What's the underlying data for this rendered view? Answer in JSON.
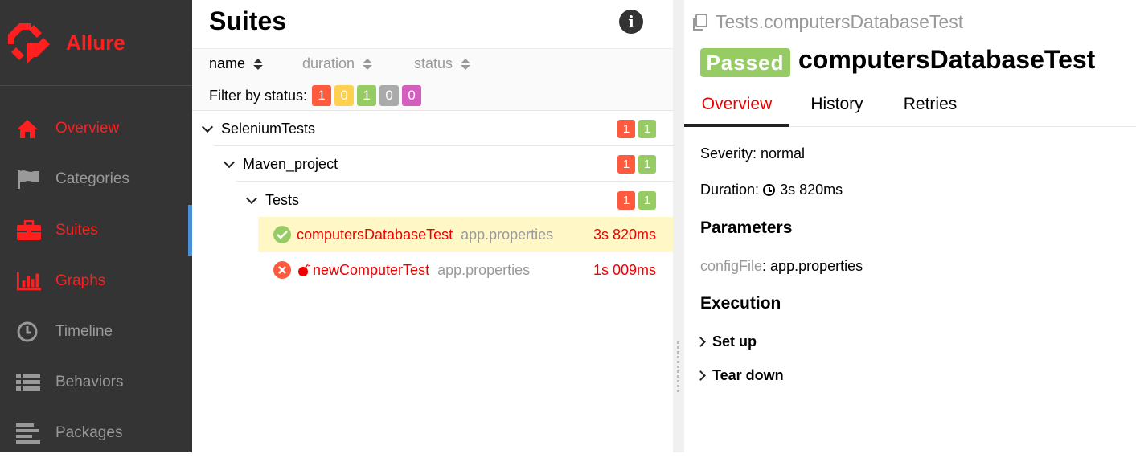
{
  "brand": {
    "name": "Allure"
  },
  "colors": {
    "failed": "#fd5a3e",
    "broken": "#ffd050",
    "passed": "#97cc64",
    "skipped": "#aaaaaa",
    "unknown": "#d35ebe",
    "accent": "#ff1f1f"
  },
  "sidebar": {
    "items": [
      {
        "label": "Overview",
        "icon": "home-icon",
        "active": true
      },
      {
        "label": "Categories",
        "icon": "flag-icon",
        "active": false
      },
      {
        "label": "Suites",
        "icon": "briefcase-icon",
        "active": true
      },
      {
        "label": "Graphs",
        "icon": "bar-chart-icon",
        "active": true
      },
      {
        "label": "Timeline",
        "icon": "clock-icon",
        "active": false
      },
      {
        "label": "Behaviors",
        "icon": "list-icon",
        "active": false
      },
      {
        "label": "Packages",
        "icon": "align-left-icon",
        "active": false
      }
    ]
  },
  "suites": {
    "title": "Suites",
    "sort": {
      "name": "name",
      "duration": "duration",
      "status": "status"
    },
    "filter": {
      "label": "Filter by status:",
      "counts": [
        "1",
        "0",
        "1",
        "0",
        "0"
      ]
    },
    "tree": {
      "root": {
        "name": "SeleniumTests",
        "failed": "1",
        "passed": "1"
      },
      "project": {
        "name": "Maven_project",
        "failed": "1",
        "passed": "1"
      },
      "group": {
        "name": "Tests",
        "failed": "1",
        "passed": "1"
      },
      "tests": [
        {
          "name": "computersDatabaseTest",
          "param": "app.properties",
          "duration": "3s 820ms",
          "status": "passed"
        },
        {
          "name": "newComputerTest",
          "param": "app.properties",
          "duration": "1s 009ms",
          "status": "failed"
        }
      ]
    }
  },
  "detail": {
    "breadcrumb": "Tests.computersDatabaseTest",
    "status": "Passed",
    "title": "computersDatabaseTest",
    "tabs": [
      "Overview",
      "History",
      "Retries"
    ],
    "severity": "Severity: normal",
    "duration_label": "Duration:",
    "duration": "3s 820ms",
    "parameters_heading": "Parameters",
    "param_key": "configFile",
    "param_value": ": app.properties",
    "execution_heading": "Execution",
    "setup": "Set up",
    "teardown": "Tear down"
  }
}
